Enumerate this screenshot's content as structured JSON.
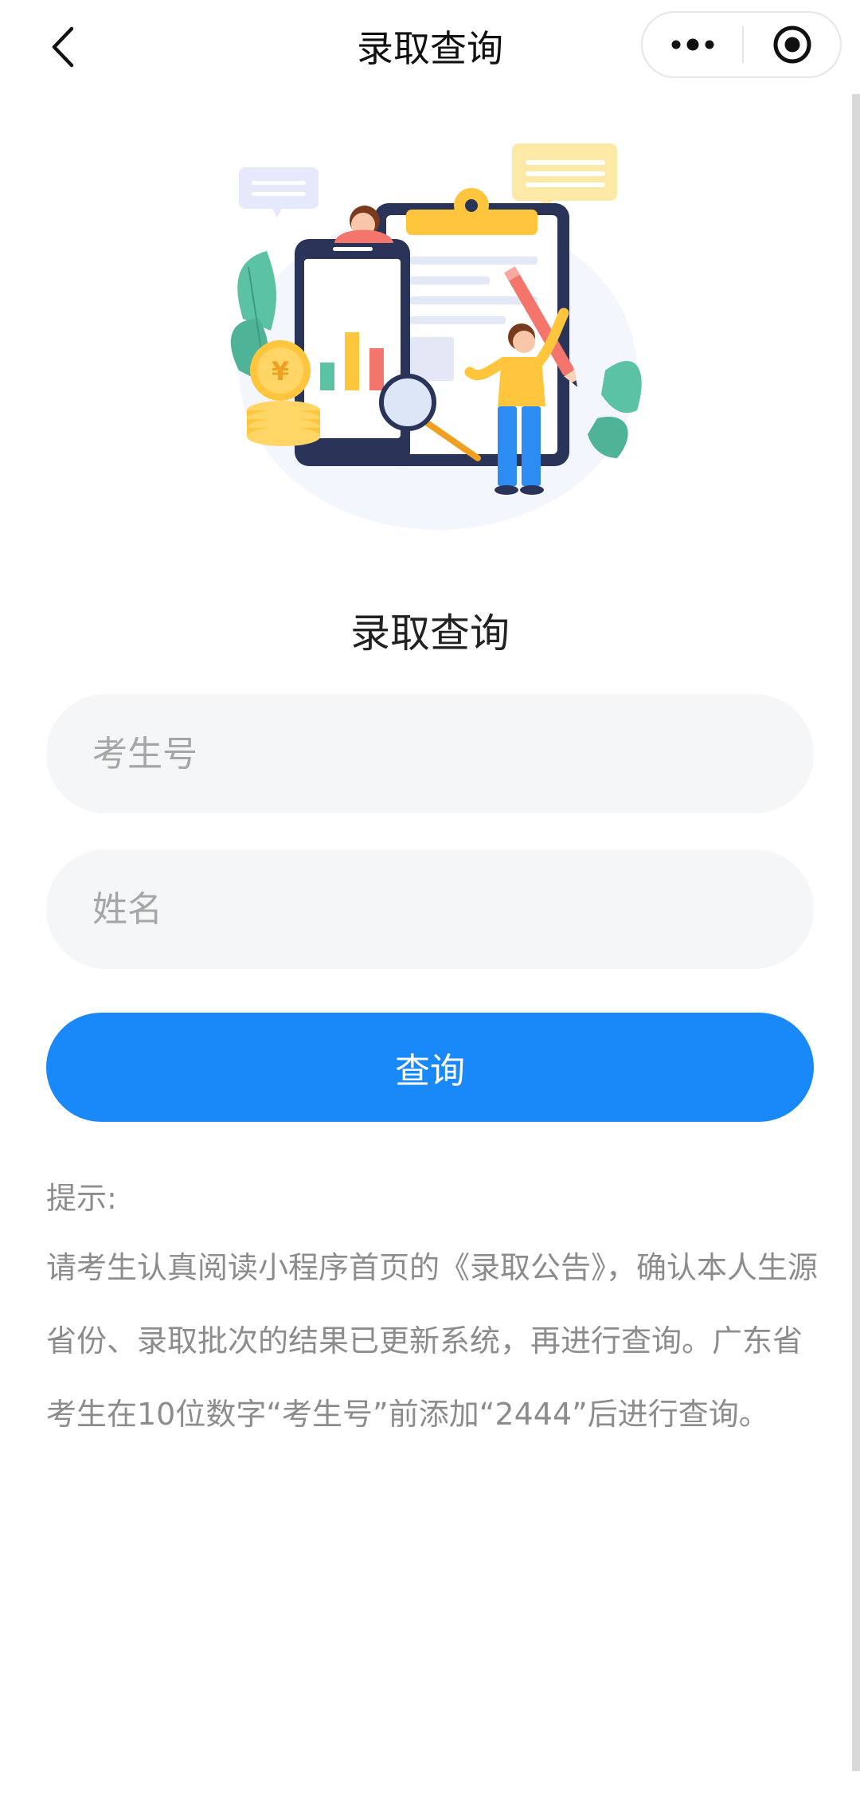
{
  "nav": {
    "title": "录取查询",
    "back_icon": "chevron-left-icon",
    "more_icon": "more-dots-icon",
    "close_icon": "target-circle-icon"
  },
  "main": {
    "heading": "录取查询",
    "exam_number": {
      "placeholder": "考生号",
      "value": ""
    },
    "name": {
      "placeholder": "姓名",
      "value": ""
    },
    "submit_label": "查询"
  },
  "tips": {
    "label": "提示:",
    "body": "请考生认真阅读小程序首页的《录取公告》，确认本人生源省份、录取批次的结果已更新系统，再进行查询。广东省考生在10位数字“考生号”前添加“2444”后进行查询。"
  },
  "colors": {
    "primary": "#1989fa",
    "input_bg": "#f5f6f7",
    "hint_text": "#8c8c8c"
  }
}
